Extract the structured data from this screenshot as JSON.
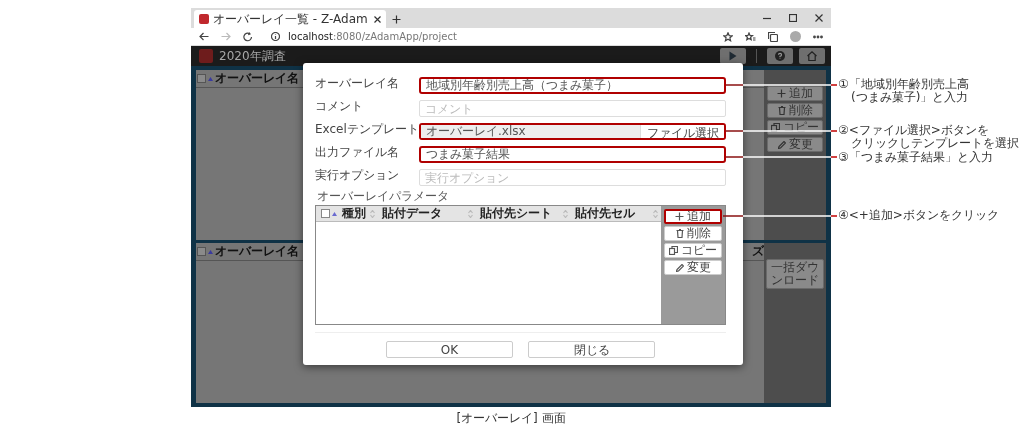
{
  "browser": {
    "tab_title": "オーバーレイ一覧 - Z-Adam",
    "url_host": "localhost",
    "url_rest": ":8080/zAdamApp/project"
  },
  "app": {
    "project_title": "2020年調査",
    "upper_list": {
      "all_checked": false,
      "columns": [
        "オーバーレイ名"
      ]
    },
    "side_buttons": [
      "追加",
      "削除",
      "コピー",
      "変更"
    ],
    "lower_list": {
      "all_checked": false,
      "columns": [
        "オーバーレイ名",
        "ズ"
      ]
    },
    "lower_button": "一括ダウンロード"
  },
  "dialog": {
    "fields": [
      {
        "kind": "text",
        "label": "オーバーレイ名",
        "value": "地域別年齢別売上高（つまみ菓子）",
        "highlighted": true
      },
      {
        "kind": "text",
        "label": "コメント",
        "placeholder": "コメント",
        "highlighted": false
      },
      {
        "kind": "file",
        "label": "Excelテンプレート",
        "value": "オーバーレイ.xlsx",
        "button": "ファイル選択",
        "highlighted": true
      },
      {
        "kind": "text",
        "label": "出力ファイル名",
        "value": "つまみ菓子結果",
        "highlighted": true
      },
      {
        "kind": "text",
        "label": "実行オプション",
        "placeholder": "実行オプション",
        "highlighted": false
      }
    ],
    "param_title": "オーバーレイパラメータ",
    "param_all_checked": false,
    "param_columns": [
      "種別",
      "貼付データ",
      "貼付先シート",
      "貼付先セル"
    ],
    "param_buttons": [
      {
        "label": "追加",
        "highlighted": true
      },
      {
        "label": "削除",
        "highlighted": false
      },
      {
        "label": "コピー",
        "highlighted": false
      },
      {
        "label": "変更",
        "highlighted": false
      }
    ],
    "footer_buttons": [
      "OK",
      "閉じる"
    ]
  },
  "annotations": [
    {
      "lines": [
        "①「地域別年齢別売上高",
        "(つまみ菓子)」と入力"
      ]
    },
    {
      "lines": [
        "②<ファイル選択>ボタンを",
        "クリックしテンプレートを選択"
      ]
    },
    {
      "lines": [
        "③「つまみ菓子結果」と入力"
      ]
    },
    {
      "lines": [
        "④<+追加>ボタンをクリック"
      ]
    }
  ],
  "caption": "[オーバーレイ] 画面"
}
